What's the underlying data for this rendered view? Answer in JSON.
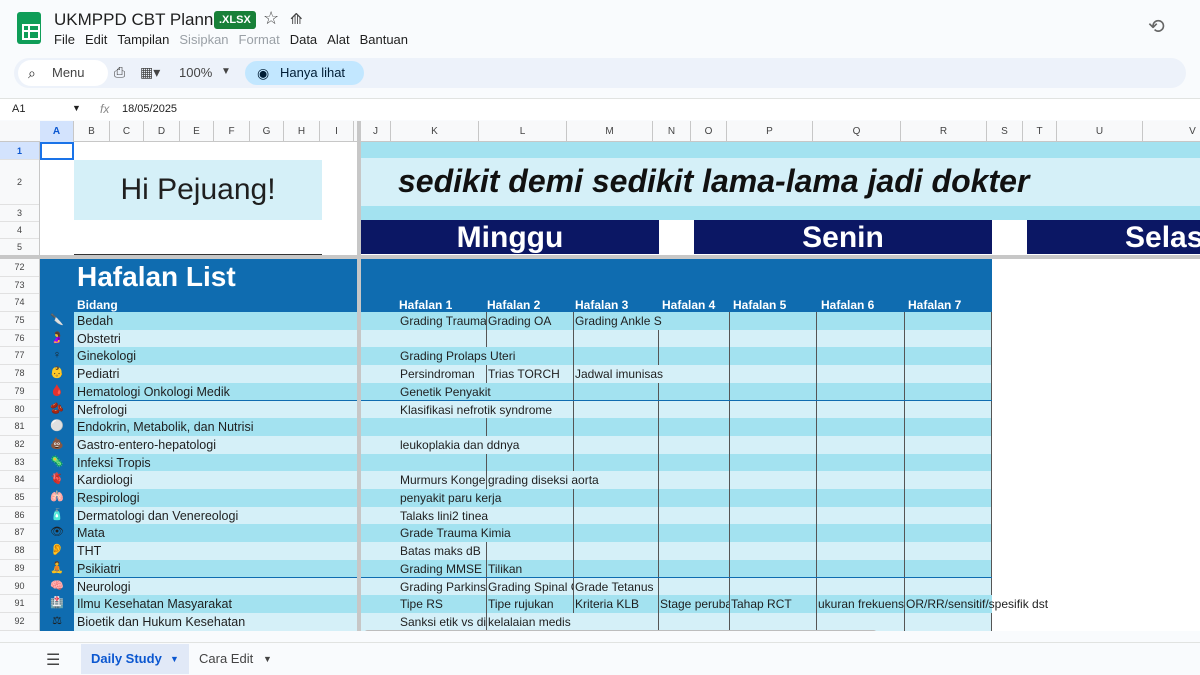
{
  "app": {
    "doc_title": "UKMPPD CBT Planner",
    "file_badge": ".XLSX",
    "menu": [
      "File",
      "Edit",
      "Tampilan",
      "Sisipkan",
      "Format",
      "Data",
      "Alat",
      "Bantuan"
    ],
    "menu_disabled": [
      "Sisipkan",
      "Format"
    ]
  },
  "toolbar": {
    "search_label": "Menu",
    "zoom": "100%",
    "view_only_label": "Hanya lihat"
  },
  "formula_bar": {
    "cell_ref": "A1",
    "fx_symbol": "fx",
    "value": "18/05/2025"
  },
  "columns": [
    "A",
    "B",
    "C",
    "D",
    "E",
    "F",
    "G",
    "H",
    "I",
    "J",
    "K",
    "L",
    "M",
    "N",
    "O",
    "P",
    "Q",
    "R",
    "S",
    "T",
    "U",
    "V"
  ],
  "top_rows": [
    "1",
    "2",
    "3",
    "4",
    "5"
  ],
  "banner": {
    "greeting": "Hi Pejuang!",
    "quote": "sedikit demi sedikit lama-lama jadi dokter",
    "days": [
      "Minggu",
      "Senin",
      "Selasa"
    ]
  },
  "hafalan": {
    "title": "Hafalan List",
    "bidang_header": "Bidang",
    "headers": [
      "Hafalan 1",
      "Hafalan 2",
      "Hafalan 3",
      "Hafalan 4",
      "Hafalan 5",
      "Hafalan 6",
      "Hafalan 7"
    ],
    "title_rows": [
      "72",
      "73",
      "74"
    ],
    "rows": [
      {
        "num": "75",
        "icon": "🔪",
        "bidang": "Bedah",
        "cells": [
          "Grading Trauma",
          "Grading OA",
          "Grading Ankle S",
          "",
          "",
          "",
          ""
        ]
      },
      {
        "num": "76",
        "icon": "🤰",
        "bidang": "Obstetri",
        "cells": [
          "",
          "",
          "",
          "",
          "",
          "",
          ""
        ]
      },
      {
        "num": "77",
        "icon": "♀",
        "bidang": "Ginekologi",
        "cells": [
          "Grading Prolaps Uteri",
          "",
          "",
          "",
          "",
          "",
          ""
        ]
      },
      {
        "num": "78",
        "icon": "👶",
        "bidang": "Pediatri",
        "cells": [
          "Persindroman",
          "Trias TORCH",
          "Jadwal imunisas",
          "",
          "",
          "",
          ""
        ]
      },
      {
        "num": "79",
        "icon": "🩸",
        "bidang": "Hematologi Onkologi Medik",
        "cells": [
          "Genetik Penyakit",
          "",
          "",
          "",
          "",
          "",
          ""
        ]
      },
      {
        "num": "80",
        "icon": "🫘",
        "bidang": "Nefrologi",
        "cells": [
          "Klasifikasi nefrotik syndrome",
          "",
          "",
          "",
          "",
          "",
          ""
        ]
      },
      {
        "num": "81",
        "icon": "⚪",
        "bidang": "Endokrin, Metabolik, dan Nutrisi",
        "cells": [
          "",
          "",
          "",
          "",
          "",
          "",
          ""
        ]
      },
      {
        "num": "82",
        "icon": "💩",
        "bidang": "Gastro-entero-hepatologi",
        "cells": [
          "leukoplakia dan ddnya",
          "",
          "",
          "",
          "",
          "",
          ""
        ]
      },
      {
        "num": "83",
        "icon": "🦠",
        "bidang": "Infeksi Tropis",
        "cells": [
          "",
          "",
          "",
          "",
          "",
          "",
          ""
        ]
      },
      {
        "num": "84",
        "icon": "🫀",
        "bidang": "Kardiologi",
        "cells": [
          "Murmurs Konger",
          "grading diseksi aorta",
          "",
          "",
          "",
          "",
          ""
        ]
      },
      {
        "num": "85",
        "icon": "🫁",
        "bidang": "Respirologi",
        "cells": [
          "penyakit paru kerja",
          "",
          "",
          "",
          "",
          "",
          ""
        ]
      },
      {
        "num": "86",
        "icon": "🧴",
        "bidang": "Dermatologi dan Venereologi",
        "cells": [
          "Talaks lini2 tinea",
          "",
          "",
          "",
          "",
          "",
          ""
        ]
      },
      {
        "num": "87",
        "icon": "👁",
        "bidang": "Mata",
        "cells": [
          "Grade Trauma Kimia",
          "",
          "",
          "",
          "",
          "",
          ""
        ]
      },
      {
        "num": "88",
        "icon": "👂",
        "bidang": "THT",
        "cells": [
          "Batas maks dB",
          "",
          "",
          "",
          "",
          "",
          ""
        ]
      },
      {
        "num": "89",
        "icon": "🧘",
        "bidang": "Psikiatri",
        "cells": [
          "Grading MMSE",
          "Tilikan",
          "",
          "",
          "",
          "",
          ""
        ]
      },
      {
        "num": "90",
        "icon": "🧠",
        "bidang": "Neurologi",
        "cells": [
          "Grading Parkinsc",
          "Grading Spinal C",
          "Grade Tetanus",
          "",
          "",
          "",
          ""
        ]
      },
      {
        "num": "91",
        "icon": "🏥",
        "bidang": "Ilmu Kesehatan Masyarakat",
        "cells": [
          "Tipe RS",
          "Tipe rujukan",
          "Kriteria KLB",
          "Stage perubal",
          "Tahap RCT",
          "ukuran frekuensi",
          "OR/RR/sensitif/spesifik dst"
        ]
      },
      {
        "num": "92",
        "icon": "⚖",
        "bidang": "Bioetik dan Hukum Kesehatan",
        "cells": [
          "Sanksi etik vs dis",
          "kelalaian medis",
          "",
          "",
          "",
          "",
          ""
        ]
      }
    ]
  },
  "tabs": [
    {
      "label": "Daily Study",
      "active": true
    },
    {
      "label": "Cara Edit",
      "active": false
    }
  ],
  "colors": {
    "row_light": "#d5f0f8",
    "row_dark": "#a3e2f0",
    "hafalan_blue": "#0f6cb0",
    "day_navy": "#0b1764"
  }
}
